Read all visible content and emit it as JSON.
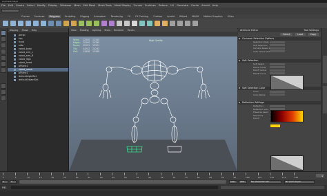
{
  "window": {
    "title": "Autodesk Maya"
  },
  "menubar": {
    "items": [
      "File",
      "Edit",
      "Create",
      "Select",
      "Modify",
      "Display",
      "Windows",
      "Mesh",
      "Edit Mesh",
      "Mesh Tools",
      "Mesh Display",
      "Curves",
      "Surfaces",
      "Deform",
      "UV",
      "Generate",
      "Cache",
      "Arnold",
      "Help"
    ]
  },
  "shelf": {
    "tabs": [
      "Curves",
      "Surfaces",
      "Polygons",
      "Sculpting",
      "Rigging",
      "Animation",
      "Rendering",
      "FX",
      "FX Caching",
      "Custom",
      "Arnold",
      "Bifrost",
      "MASH",
      "Motion Graphics",
      "XGen"
    ],
    "active_index": 2
  },
  "outliner": {
    "menu": [
      "Display",
      "Show",
      "Help"
    ],
    "items": [
      {
        "label": "persp",
        "selected": false
      },
      {
        "label": "top",
        "selected": false
      },
      {
        "label": "front",
        "selected": false
      },
      {
        "label": "side",
        "selected": false
      },
      {
        "label": "robot_body",
        "selected": false
      },
      {
        "label": "robot_arm_L",
        "selected": false
      },
      {
        "label": "robot_arm_R",
        "selected": false
      },
      {
        "label": "robot_legs",
        "selected": false
      },
      {
        "label": "robot_head",
        "selected": false
      },
      {
        "label": "pPlane1",
        "selected": false
      },
      {
        "label": "robot_mesh",
        "selected": true
      },
      {
        "label": "pPlane1",
        "selected": false
      },
      {
        "label": "defaultLightSet",
        "selected": false
      },
      {
        "label": "defaultObjectSet",
        "selected": false
      }
    ]
  },
  "viewport": {
    "menu": [
      "View",
      "Shading",
      "Lighting",
      "Show",
      "Renderer",
      "Panels"
    ],
    "hud": {
      "rows": [
        {
          "label": "Verts:",
          "a": "12345",
          "b": "12345"
        },
        {
          "label": "Edges:",
          "a": "24390",
          "b": "24390"
        },
        {
          "label": "Faces:",
          "a": "12121",
          "b": "12121"
        },
        {
          "label": "Tris:",
          "a": "24242",
          "b": "24242"
        },
        {
          "label": "UVs:",
          "a": "13458",
          "b": "13458"
        }
      ],
      "title": "High Quality"
    }
  },
  "attribute_editor": {
    "tabs": {
      "left": "Attribute Editor",
      "right": "Tool Settings"
    },
    "buttons": [
      "Select",
      "Load",
      "Copy"
    ],
    "sections": [
      {
        "title": "Common Selection Options",
        "rows": [
          "Selection Style",
          "Soft Selection",
          "Camera based selection",
          "Auto select back faces"
        ]
      },
      {
        "title": "Soft Selection",
        "rows": [
          "Soft Select",
          "Falloff mode",
          "Falloff radius",
          "Falloff curve"
        ]
      },
      {
        "title": "Soft Selection Color",
        "rows": [
          "Color",
          "Color Ramp"
        ]
      },
      {
        "title": "Reflection Settings",
        "rows": [
          "Reflection",
          "Reflection axis",
          "Preserve seam",
          "Tolerance",
          "Falloff"
        ]
      }
    ]
  },
  "timeline": {
    "ticks": [
      "1",
      "5",
      "10",
      "15",
      "20",
      "25",
      "30",
      "35",
      "40",
      "45",
      "50",
      "55",
      "60",
      "65",
      "70",
      "75",
      "80",
      "85",
      "90",
      "95",
      "100",
      "105",
      "110",
      "115",
      "120"
    ],
    "current_frame": "1"
  },
  "range": {
    "start": "1",
    "start_inner": "1",
    "end_inner": "120",
    "end": "200",
    "character_set": "No Character Set",
    "anim_layer": "No Anim Layer"
  },
  "cmdline": {
    "label": "MEL"
  },
  "colors": {
    "accent": "#566c86",
    "ramp_start": "#000000",
    "ramp_end": "#ffd400",
    "hud_green": "#b8ffb8",
    "mesh": "#ffffff"
  }
}
